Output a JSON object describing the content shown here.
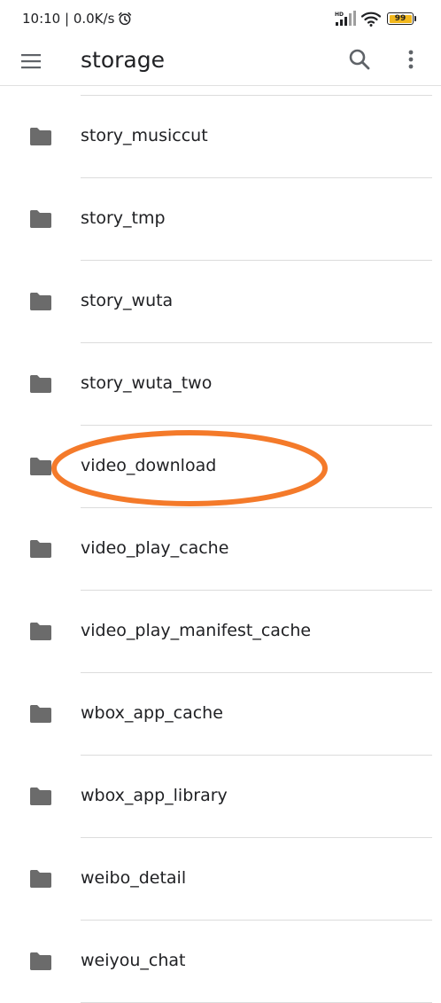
{
  "status_bar": {
    "time_speed": "10:10 | 0.0K/s",
    "network_label": "HD",
    "battery_level": "99",
    "battery_color": "#f2b81e"
  },
  "toolbar": {
    "title": "storage",
    "menu_icon": "hamburger-menu-icon",
    "search_icon": "search-icon",
    "more_icon": "more-vert-icon"
  },
  "folders": [
    {
      "name": "story_musiccut",
      "icon": "folder-icon"
    },
    {
      "name": "story_tmp",
      "icon": "folder-icon"
    },
    {
      "name": "story_wuta",
      "icon": "folder-icon"
    },
    {
      "name": "story_wuta_two",
      "icon": "folder-icon"
    },
    {
      "name": "video_download",
      "icon": "folder-icon",
      "highlighted": true
    },
    {
      "name": "video_play_cache",
      "icon": "folder-icon"
    },
    {
      "name": "video_play_manifest_cache",
      "icon": "folder-icon"
    },
    {
      "name": "wbox_app_cache",
      "icon": "folder-icon"
    },
    {
      "name": "wbox_app_library",
      "icon": "folder-icon"
    },
    {
      "name": "weibo_detail",
      "icon": "folder-icon"
    },
    {
      "name": "weiyou_chat",
      "icon": "folder-icon"
    }
  ],
  "colors": {
    "folder_icon": "#6b6b6b",
    "highlight_annotation": "#f47a2a",
    "divider": "#dcdcdc"
  }
}
